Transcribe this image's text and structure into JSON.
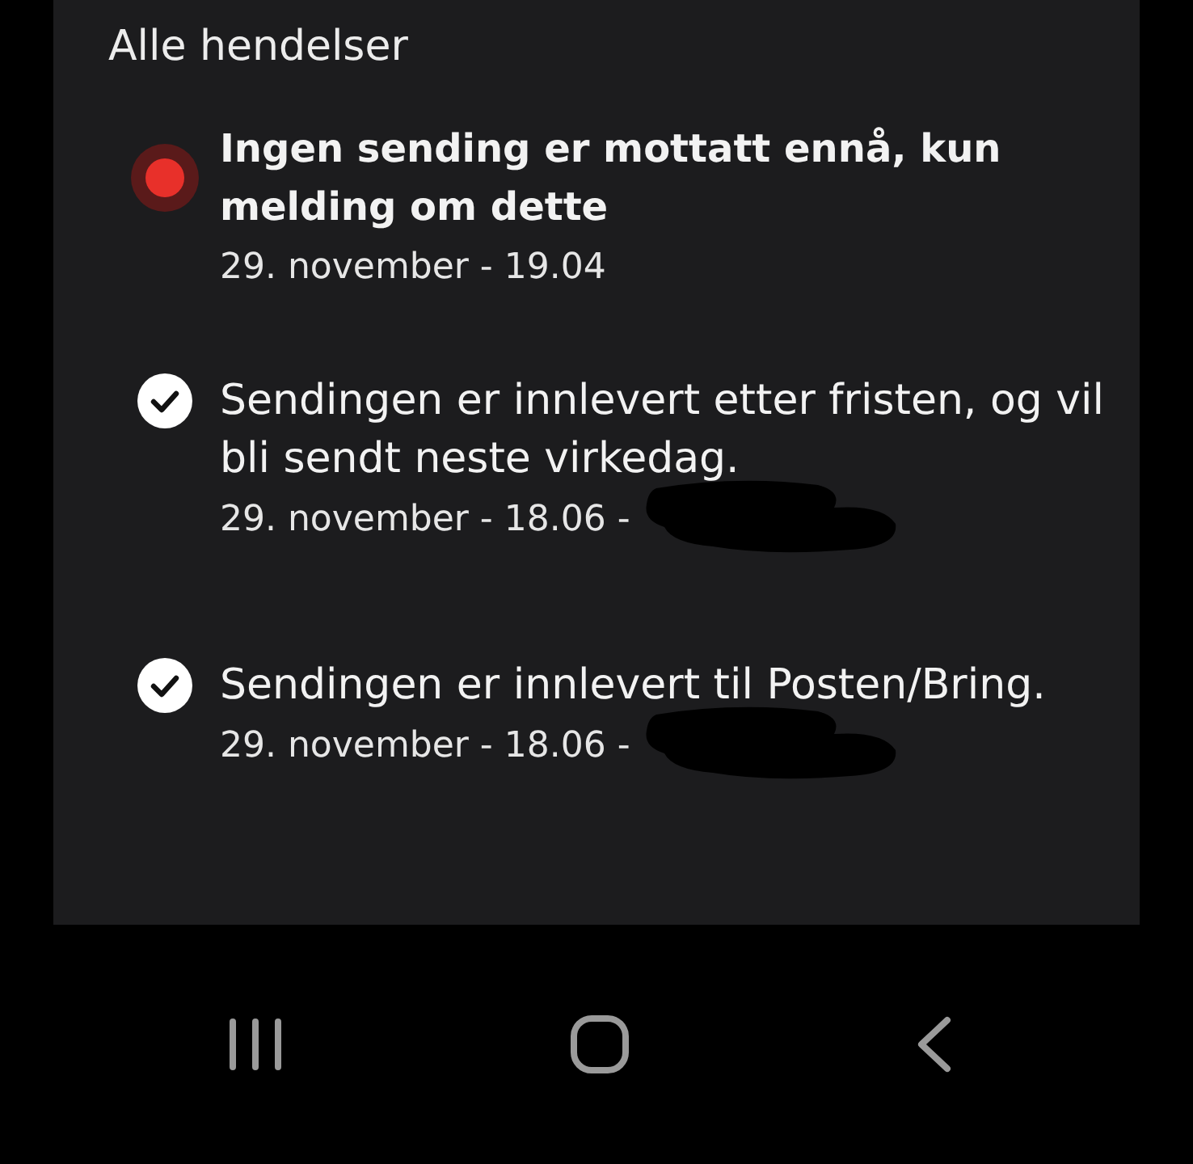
{
  "section": {
    "title": "Alle hendelser"
  },
  "events": [
    {
      "kind": "pending",
      "title": "Ingen sending er mottatt ennå, kun melding om dette",
      "time": "29. november - 19.04",
      "redacted": false
    },
    {
      "kind": "done",
      "title": "Sendingen er innlevert etter fristen, og vil bli sendt neste virkedag.",
      "time": "29. november - 18.06 -",
      "redacted": true
    },
    {
      "kind": "done",
      "title": "Sendingen er innlevert til Posten/Bring.",
      "time": "29. november - 18.06 -",
      "redacted": true
    }
  ]
}
